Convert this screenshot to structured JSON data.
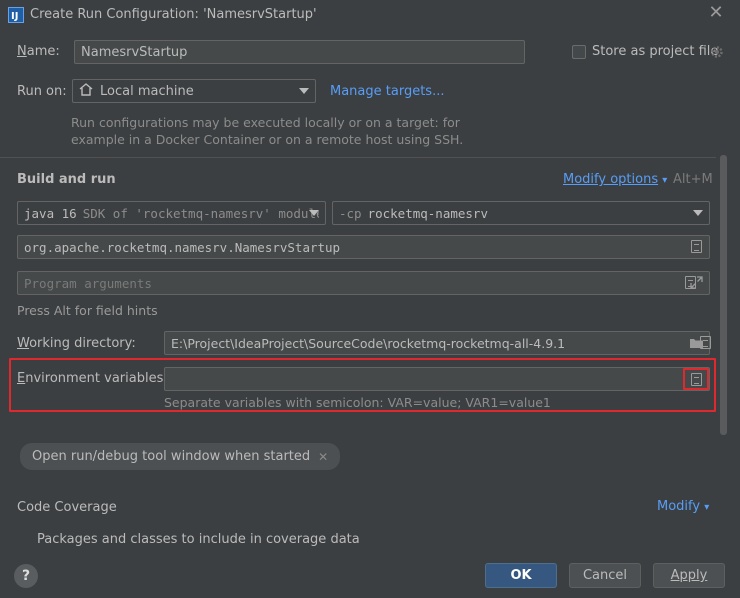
{
  "window": {
    "title": "Create Run Configuration: 'NamesrvStartup'"
  },
  "name": {
    "label": "Name:",
    "value": "NamesrvStartup"
  },
  "store": {
    "label": "Store as project file"
  },
  "run_on": {
    "label": "Run on:",
    "value": "Local machine",
    "manage_link": "Manage targets...",
    "hint_line1": "Run configurations may be executed locally or on a target: for",
    "hint_line2": "example in a Docker Container or on a remote host using SSH."
  },
  "build": {
    "title": "Build and run",
    "modify_options": "Modify options",
    "shortcut": "Alt+M",
    "sdk_version": "java 16",
    "sdk_detail": "SDK of 'rocketmq-namesrv' module",
    "cp_flag": "-cp",
    "cp_value": "rocketmq-namesrv",
    "main_class": "org.apache.rocketmq.namesrv.NamesrvStartup",
    "program_args_placeholder": "Program arguments",
    "field_hint": "Press Alt for field hints"
  },
  "working_dir": {
    "label": "Working directory:",
    "value": "E:\\Project\\IdeaProject\\SourceCode\\rocketmq-rocketmq-all-4.9.1"
  },
  "env": {
    "label": "Environment variables:",
    "value": "",
    "hint": "Separate variables with semicolon: VAR=value; VAR1=value1"
  },
  "open_tool_window": {
    "label": "Open run/debug tool window when started"
  },
  "coverage": {
    "title": "Code Coverage",
    "modify": "Modify",
    "packages": "Packages and classes to include in coverage data"
  },
  "footer": {
    "help": "?",
    "ok": "OK",
    "cancel": "Cancel",
    "apply": "Apply"
  },
  "colors": {
    "accent": "#589df6",
    "highlight": "#e0282f",
    "primary_button": "#365880"
  }
}
